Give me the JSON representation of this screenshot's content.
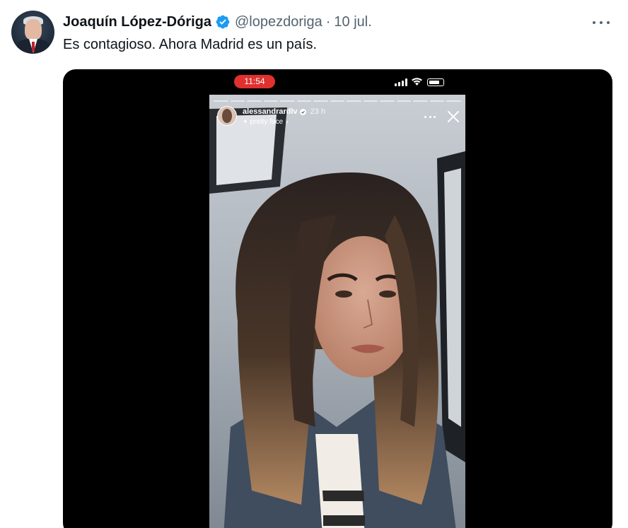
{
  "author": {
    "name": "Joaquín López-Dóriga",
    "handle": "@lopezdoriga",
    "separator": "·",
    "date": "10 jul."
  },
  "tweet": {
    "text": "Es contagioso. Ahora Madrid es un país."
  },
  "icons": {
    "verified": "verified-badge-icon",
    "more": "more-options-icon"
  },
  "colors": {
    "verified_blue": "#1d9bf0",
    "text_primary": "#0f1419",
    "text_secondary": "#536471",
    "recording_red": "#e0312e"
  },
  "media": {
    "phone_time": "11:54",
    "story": {
      "username": "alessandrardlv",
      "time_ago": "23 h",
      "music_label": "pretty face",
      "sparkle": "✦",
      "chevron": "›"
    }
  }
}
